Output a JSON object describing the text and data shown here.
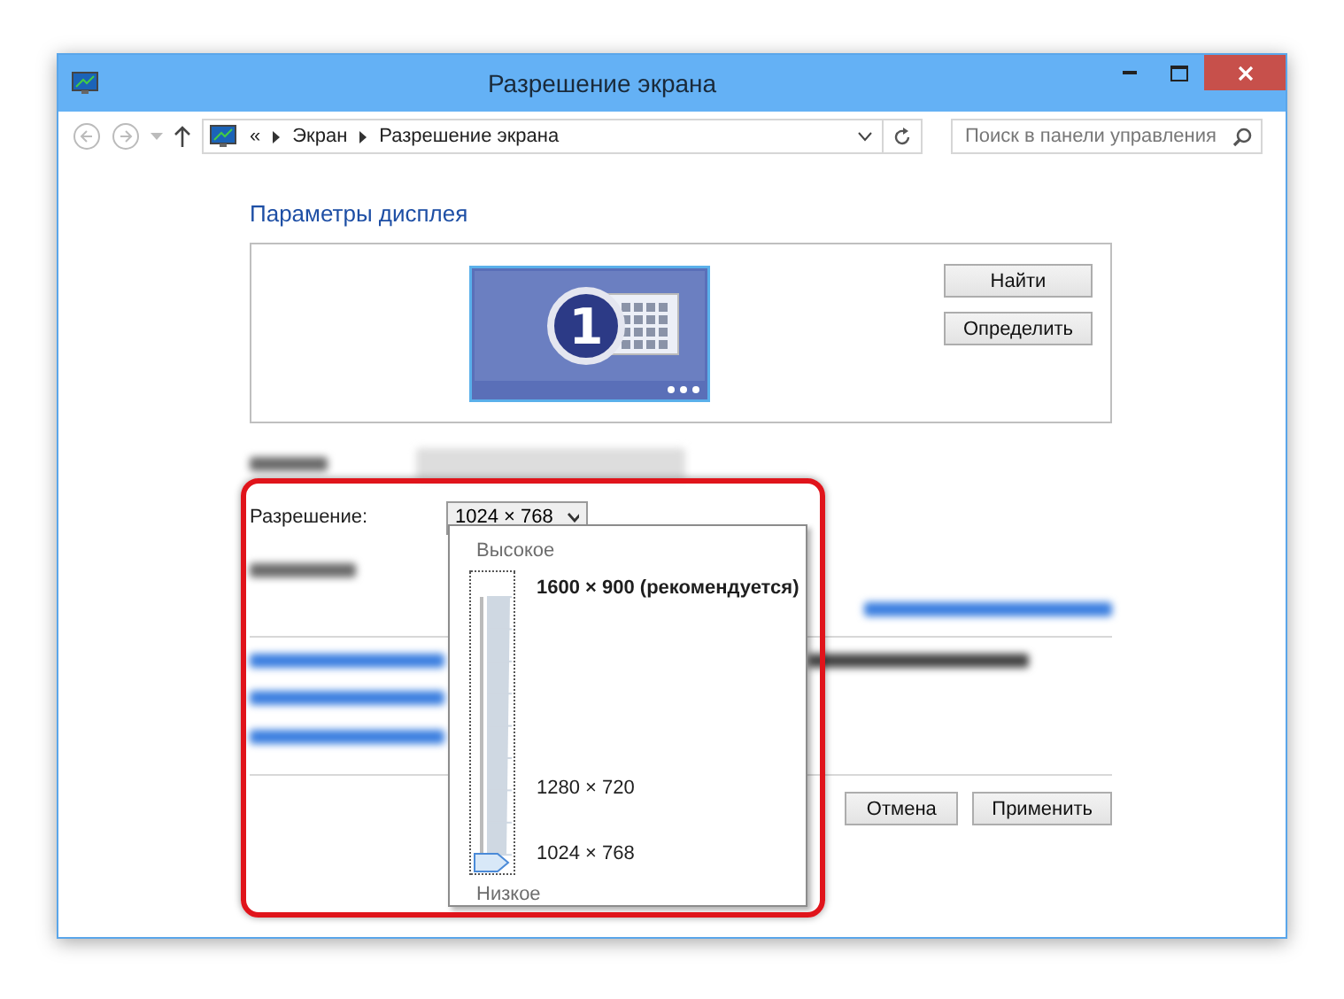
{
  "window": {
    "title": "Разрешение экрана"
  },
  "address_bar": {
    "crumbs": [
      "«",
      "Экран",
      "Разрешение экрана"
    ]
  },
  "search": {
    "placeholder": "Поиск в панели управления"
  },
  "heading": "Параметры дисплея",
  "monitor": {
    "number": "1"
  },
  "side_buttons": [
    "Найти",
    "Определить"
  ],
  "resolution": {
    "label": "Разрешение:",
    "value": "1024 × 768"
  },
  "slider": {
    "high_label": "Высокое",
    "low_label": "Низкое",
    "level": 0,
    "marks": [
      {
        "label": "1600 × 900 (рекомендуется)",
        "bold": true
      },
      {
        "label": "1280 × 720",
        "bold": false
      },
      {
        "label": "1024 × 768",
        "bold": false
      }
    ]
  },
  "footer_buttons": [
    "Отмена",
    "Применить"
  ]
}
